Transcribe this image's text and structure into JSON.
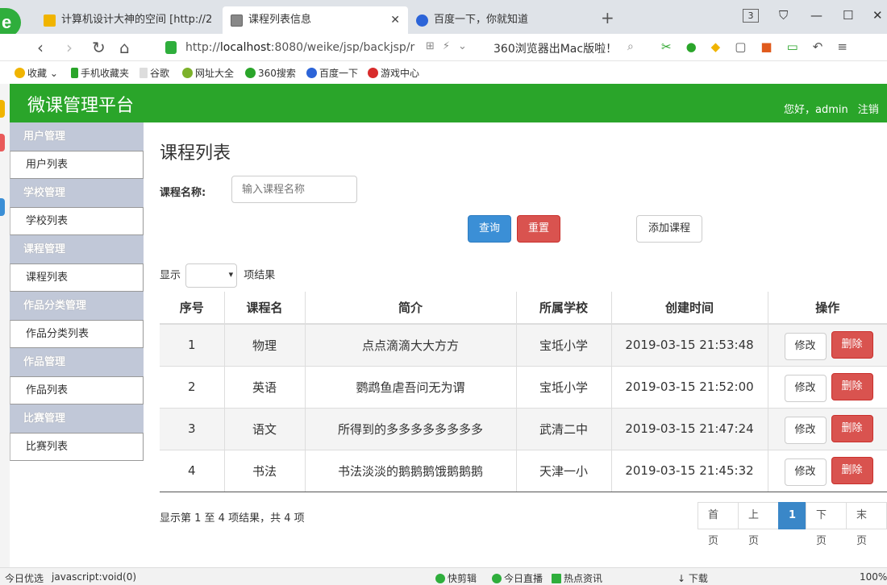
{
  "browser": {
    "tabs": [
      {
        "title": "计算机设计大神的空间 [http://2",
        "active": false,
        "icon_color": "#f0b400"
      },
      {
        "title": "课程列表信息",
        "active": true,
        "icon_color": "#888888"
      },
      {
        "title": "百度一下，你就知道",
        "active": false,
        "icon_color": "#2c64d8"
      }
    ],
    "tab_count": "3",
    "url_prefix": "http://",
    "url_host": "localhost",
    "url_rest": ":8080/weike/jsp/backjsp/r",
    "promo": "360浏览器出Mac版啦！",
    "bookmarks": [
      "收藏",
      "手机收藏夹",
      "谷歌",
      "网址大全",
      "360搜索",
      "百度一下",
      "游戏中心"
    ]
  },
  "app": {
    "title": "微课管理平台",
    "greeting": "您好，admin",
    "logout": "注销"
  },
  "sidebar": {
    "groups": [
      {
        "title": "用户管理",
        "item": "用户列表"
      },
      {
        "title": "学校管理",
        "item": "学校列表"
      },
      {
        "title": "课程管理",
        "item": "课程列表"
      },
      {
        "title": "作品分类管理",
        "item": "作品分类列表"
      },
      {
        "title": "作品管理",
        "item": "作品列表"
      },
      {
        "title": "比赛管理",
        "item": "比赛列表"
      }
    ]
  },
  "main": {
    "page_title": "课程列表",
    "filter_label": "课程名称:",
    "filter_placeholder": "输入课程名称",
    "query_label": "查询",
    "reset_label": "重置",
    "add_label": "添加课程",
    "show_prefix": "显示",
    "show_suffix": "项结果",
    "columns": [
      "序号",
      "课程名",
      "简介",
      "所属学校",
      "创建时间",
      "操作"
    ],
    "rows": [
      [
        "1",
        "物理",
        "点点滴滴大大方方",
        "宝坻小学",
        "2019-03-15 21:53:48"
      ],
      [
        "2",
        "英语",
        "鹦鹉鱼虐吾问无为谓",
        "宝坻小学",
        "2019-03-15 21:52:00"
      ],
      [
        "3",
        "语文",
        "所得到的多多多多多多多多",
        "武清二中",
        "2019-03-15 21:47:24"
      ],
      [
        "4",
        "书法",
        "书法淡淡的鹅鹅鹅饿鹅鹅鹅",
        "天津一小",
        "2019-03-15 21:45:32"
      ]
    ],
    "edit_label": "修改",
    "delete_label": "删除",
    "info": "显示第 1 至 4 项结果，共 4 项",
    "pager": {
      "first": "首页",
      "prev": "上页",
      "current": "1",
      "next": "下页",
      "last": "末页"
    }
  },
  "statusbar": {
    "left": "今日优选",
    "link": "javascript:void(0)",
    "items": [
      "快剪辑",
      "今日直播",
      "热点资讯",
      "下载"
    ],
    "zoom": "100%"
  }
}
